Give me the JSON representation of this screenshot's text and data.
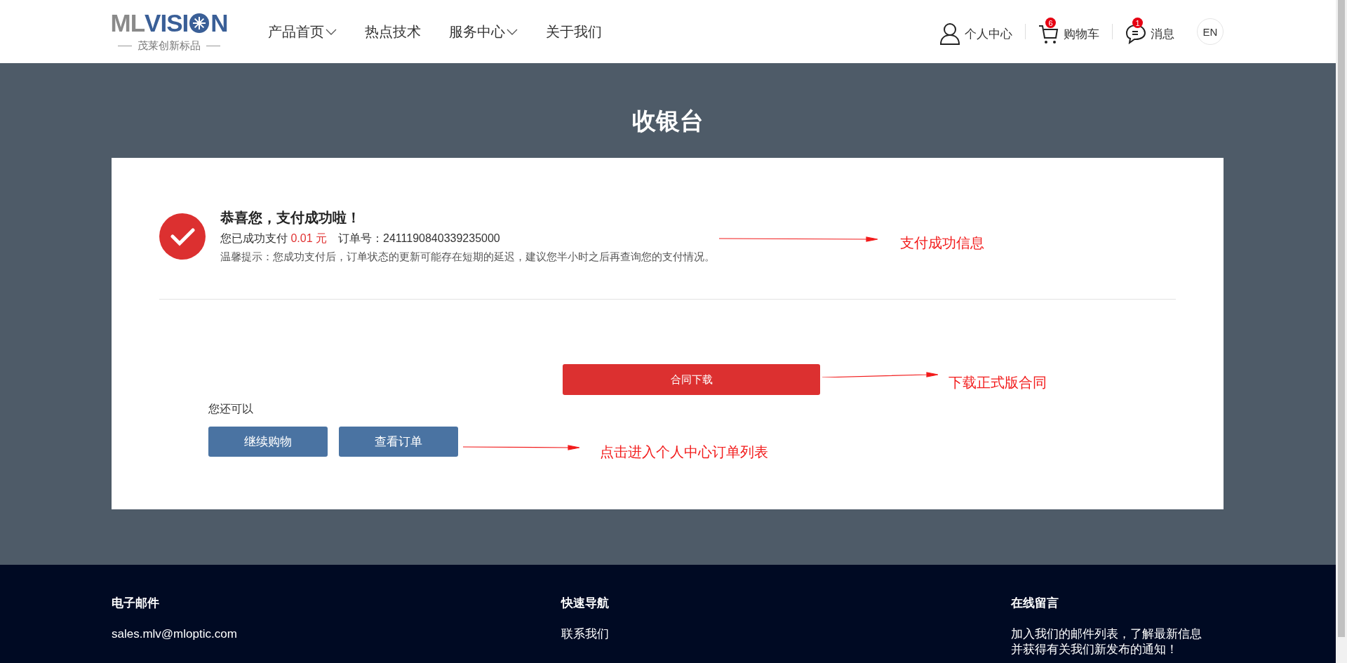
{
  "header": {
    "logo": {
      "prefix": "ML",
      "middle": "VISI",
      "suffix": "N",
      "tagline": "茂莱创新标品"
    },
    "nav": [
      {
        "label": "产品首页",
        "dropdown": true
      },
      {
        "label": "热点技术",
        "dropdown": false
      },
      {
        "label": "服务中心",
        "dropdown": true
      },
      {
        "label": "关于我们",
        "dropdown": false
      }
    ],
    "actions": [
      {
        "kind": "user",
        "label": "个人中心"
      },
      {
        "kind": "cart",
        "label": "购物车",
        "badge": "6"
      },
      {
        "kind": "message",
        "label": "消息",
        "badge": "1"
      }
    ],
    "language": "EN"
  },
  "page_title": "收银台",
  "result": {
    "title": "恭喜您，支付成功啦！",
    "paid_label": "您已成功支付",
    "amount": "0.01 元",
    "order_label": "订单号：2411190840339235000",
    "tip": "温馨提示：您成功支付后，订单状态的更新可能存在短期的延迟，建议您半小时之后再查询您的支付情况。"
  },
  "download_button": "合同下载",
  "more_label": "您还可以",
  "buttons": [
    "继续购物",
    "查看订单"
  ],
  "annotations": [
    "支付成功信息",
    "下载正式版合同",
    "点击进入个人中心订单列表"
  ],
  "footer": {
    "columns": [
      {
        "heading": "电子邮件",
        "lines": [
          "sales.mlv@mloptic.com"
        ]
      },
      {
        "heading": "快速导航",
        "lines": [
          "联系我们"
        ]
      },
      {
        "heading": "在线留言",
        "lines": [
          "加入我们的邮件列表，了解最新信息",
          "并获得有关我们新发布的通知！"
        ]
      }
    ]
  }
}
